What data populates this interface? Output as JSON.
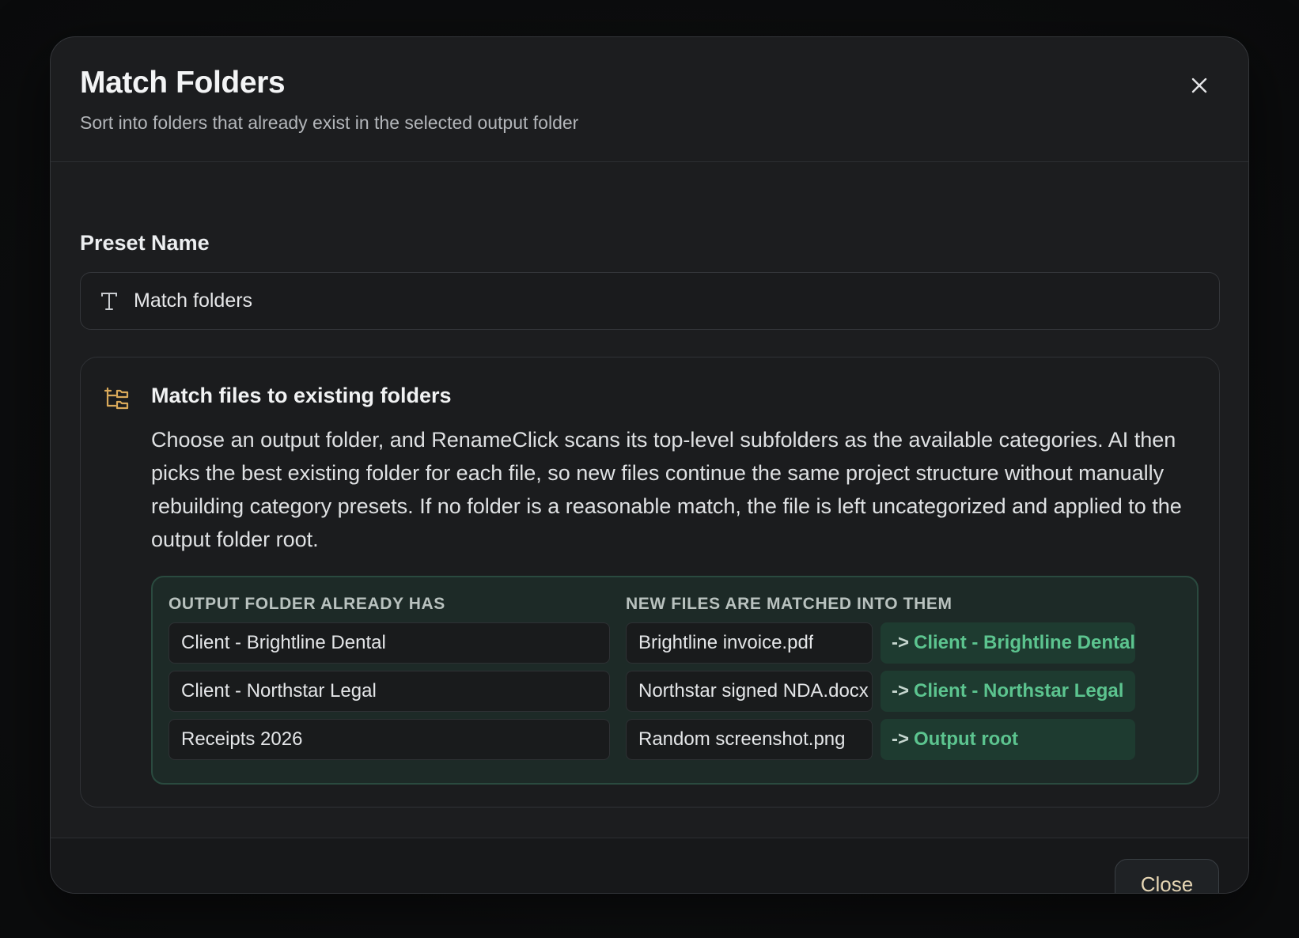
{
  "dialog": {
    "title": "Match Folders",
    "subtitle": "Sort into folders that already exist in the selected output folder",
    "close_icon": "close-icon"
  },
  "preset": {
    "label": "Preset Name",
    "icon": "text-type-icon",
    "value": "Match folders"
  },
  "info": {
    "icon": "folder-tree-icon",
    "title": "Match files to existing folders",
    "description": "Choose an output folder, and RenameClick scans its top-level subfolders as the available categories. AI then picks the best existing folder for each file, so new files continue the same project structure without manually rebuilding category presets. If no folder is a reasonable match, the file is left uncategorized and applied to the output folder root."
  },
  "example": {
    "left_header": "OUTPUT FOLDER ALREADY HAS",
    "right_header": "NEW FILES ARE MATCHED INTO THEM",
    "arrow": "->",
    "existing_folders": [
      "Client - Brightline Dental",
      "Client - Northstar Legal",
      "Receipts 2026"
    ],
    "matches": [
      {
        "file": "Brightline invoice.pdf",
        "target": "Client - Brightline Dental"
      },
      {
        "file": "Northstar signed NDA.docx",
        "target": "Client - Northstar Legal"
      },
      {
        "file": "Random screenshot.png",
        "target": "Output root"
      }
    ]
  },
  "footer": {
    "close_label": "Close"
  },
  "colors": {
    "accent_green": "#5cc48f",
    "icon_amber": "#d9a95a",
    "close_text": "#e6d6b4"
  }
}
